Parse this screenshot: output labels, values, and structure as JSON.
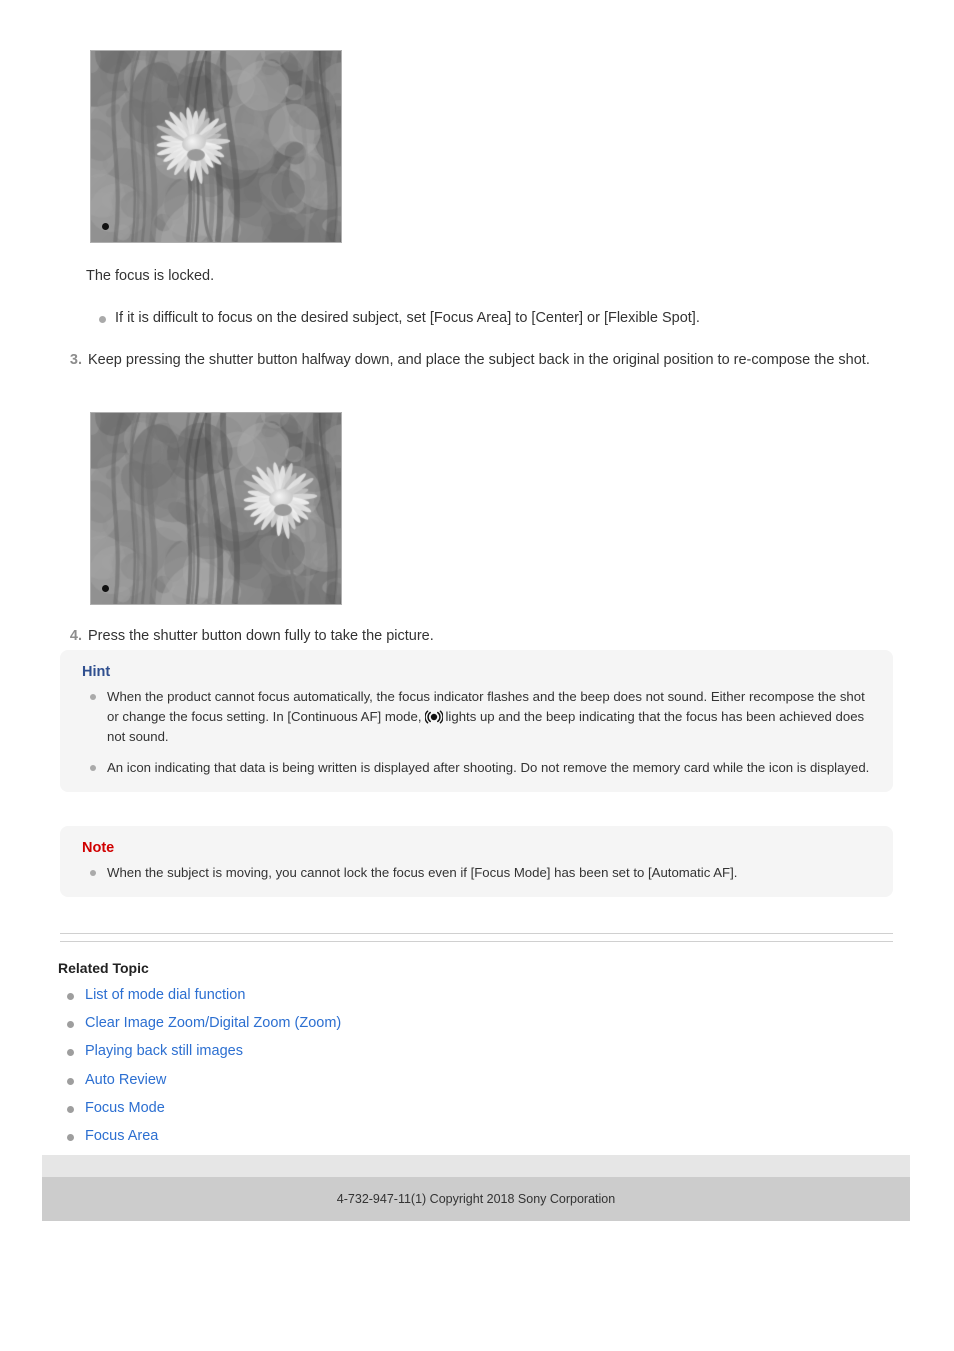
{
  "photos": [
    {
      "name": "photo-focus-locked",
      "alt": "Grayscale blurred photo of a daisy flower centered in frame with focus point marker",
      "flower_position": "center-left",
      "marker": "focus-point-dot"
    },
    {
      "name": "photo-recomposed",
      "alt": "Grayscale blurred photo of a daisy flower moved to the right of frame after re-composing",
      "flower_position": "right",
      "marker": "focus-point-dot"
    }
  ],
  "captions": {
    "focus_locked": "The focus is locked."
  },
  "focus_area_tip": "If it is difficult to focus on the desired subject, set [Focus Area] to [Center] or [Flexible Spot].",
  "steps": [
    {
      "number": "3.",
      "text": "Keep pressing the shutter button halfway down, and place the subject back in the original position to re-compose the shot."
    },
    {
      "number": "4.",
      "text": "Press the shutter button down fully to take the picture."
    }
  ],
  "hint": {
    "title": "Hint",
    "title_color": "#2f4f8f",
    "items": [
      {
        "before_icon": "When the product cannot focus automatically, the focus indicator flashes and the beep does not sound. Either recompose the shot or change the focus setting. In [Continuous AF] mode,",
        "icon": "continuous-af-indicator-icon",
        "after_icon": "lights up and the beep indicating that the focus has been achieved does not sound."
      },
      {
        "text": "An icon indicating that data is being written is displayed after shooting. Do not remove the memory card while the icon is displayed."
      }
    ]
  },
  "note": {
    "title": "Note",
    "title_color": "#d00000",
    "items": [
      "When the subject is moving, you cannot lock the focus even if [Focus Mode] has been set to [Automatic AF]."
    ]
  },
  "related_topic": {
    "heading": "Related Topic",
    "links": [
      "List of mode dial function",
      "Clear Image Zoom/Digital Zoom (Zoom)",
      "Playing back still images",
      "Auto Review",
      "Focus Mode",
      "Focus Area"
    ],
    "link_color": "#2c6fd1"
  },
  "footer": {
    "text": "4-732-947-11(1) Copyright 2018 Sony Corporation"
  }
}
